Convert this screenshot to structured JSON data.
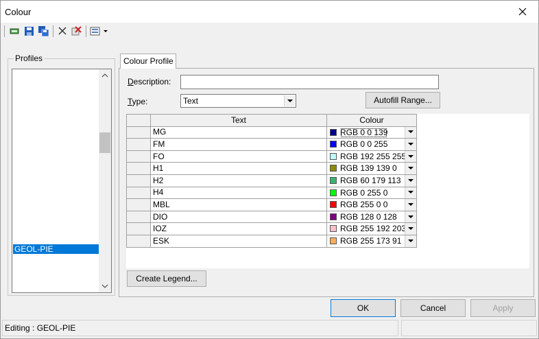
{
  "window": {
    "title": "Colour"
  },
  "toolbar": {
    "icons": [
      "new-icon",
      "save-icon",
      "save-as-icon",
      "delete-icon",
      "delete-all-icon",
      "options-icon"
    ]
  },
  "profiles": {
    "label": "Profiles",
    "items": [
      "GEOL-PIE"
    ],
    "selected": "GEOL-PIE"
  },
  "tab": {
    "label": "Colour Profile"
  },
  "form": {
    "description_label": "Description:",
    "description_value": "",
    "type_label": "Type:",
    "type_value": "Text",
    "autofill_label": "Autofill Range..."
  },
  "grid": {
    "headers": [
      "Text",
      "Colour"
    ],
    "rows": [
      {
        "text": "MG",
        "colour": "RGB 0 0 139",
        "swatch": "#00008b"
      },
      {
        "text": "FM",
        "colour": "RGB 0 0 255",
        "swatch": "#0000ff"
      },
      {
        "text": "FO",
        "colour": "RGB 192 255 255",
        "swatch": "#c0ffff"
      },
      {
        "text": "H1",
        "colour": "RGB 139 139 0",
        "swatch": "#8b8b00"
      },
      {
        "text": "H2",
        "colour": "RGB 60 179 113",
        "swatch": "#3cb371"
      },
      {
        "text": "H4",
        "colour": "RGB 0 255 0",
        "swatch": "#00ff00"
      },
      {
        "text": "MBL",
        "colour": "RGB 255 0 0",
        "swatch": "#ff0000"
      },
      {
        "text": "DIO",
        "colour": "RGB 128 0 128",
        "swatch": "#800080"
      },
      {
        "text": "IOZ",
        "colour": "RGB 255 192 203",
        "swatch": "#ffc0cb"
      },
      {
        "text": "ESK",
        "colour": "RGB 255 173 91",
        "swatch": "#ffad5b"
      }
    ]
  },
  "buttons": {
    "create_legend": "Create Legend...",
    "ok": "OK",
    "cancel": "Cancel",
    "apply": "Apply"
  },
  "status": {
    "text": "Editing : GEOL-PIE"
  }
}
